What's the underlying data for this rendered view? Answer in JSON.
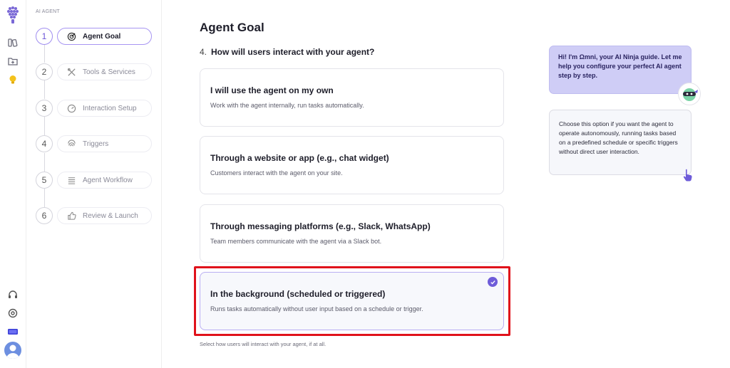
{
  "rail": {
    "icons": [
      "logo-icon",
      "library-icon",
      "folder-add-icon",
      "lightbulb-icon",
      "headset-icon",
      "settings-icon",
      "battery-icon",
      "avatar"
    ]
  },
  "steps": {
    "section_label": "AI AGENT",
    "items": [
      {
        "num": "1",
        "label": "Agent Goal",
        "icon": "target-icon",
        "active": true
      },
      {
        "num": "2",
        "label": "Tools & Services",
        "icon": "tools-icon",
        "active": false
      },
      {
        "num": "3",
        "label": "Interaction Setup",
        "icon": "gauge-icon",
        "active": false
      },
      {
        "num": "4",
        "label": "Triggers",
        "icon": "fingerprint-icon",
        "active": false
      },
      {
        "num": "5",
        "label": "Agent Workflow",
        "icon": "list-icon",
        "active": false
      },
      {
        "num": "6",
        "label": "Review & Launch",
        "icon": "thumbs-up-icon",
        "active": false
      }
    ]
  },
  "main": {
    "title": "Agent Goal",
    "question_number": "4.",
    "question": "How will users interact with your agent?",
    "options": [
      {
        "title": "I will use the agent on my own",
        "description": "Work with the agent internally, run tasks automatically.",
        "selected": false
      },
      {
        "title": "Through a website or app (e.g., chat widget)",
        "description": "Customers interact with the agent on your site.",
        "selected": false
      },
      {
        "title": "Through messaging platforms (e.g., Slack, WhatsApp)",
        "description": "Team members communicate with the agent via a Slack bot.",
        "selected": false
      },
      {
        "title": "In the background (scheduled or triggered)",
        "description": "Runs tasks automatically without user input based on a schedule or trigger.",
        "selected": true
      }
    ],
    "helper_text": "Select how users will interact with your agent, if at all."
  },
  "guide": {
    "bubble": "Hi! I'm Ωmni, your AI Ninja guide. Let me help you configure your perfect AI agent step by step.",
    "hint": "Choose this option if you want the agent to operate autonomously, running tasks based on a predefined schedule or specific triggers without direct user interaction."
  },
  "colors": {
    "accent": "#6e5cd9",
    "highlight_border": "#e0121b",
    "bubble_bg": "#cfcdf6"
  }
}
